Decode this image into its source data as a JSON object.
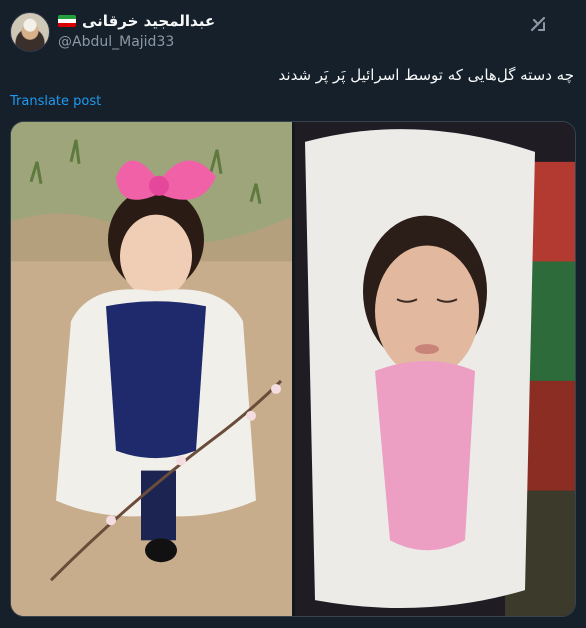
{
  "author": {
    "display_name": "عبدالمجید خرقانی",
    "handle": "@Abdul_Majid33",
    "flag_colors": [
      "#239f40",
      "#ffffff",
      "#da0000"
    ]
  },
  "tweet": {
    "text": "چه دسته گل‌هایی که توسط اسرائیل پَر پَر شدند",
    "translate_label": "Translate post"
  },
  "icons": {
    "header_action": "grok-icon",
    "avatar": "avatar-photo"
  },
  "colors": {
    "background": "#15202b",
    "text": "#f7f9f9",
    "muted": "#8b98a5",
    "link": "#1d9bf0",
    "border": "#38444d"
  },
  "media": {
    "count": 2
  }
}
